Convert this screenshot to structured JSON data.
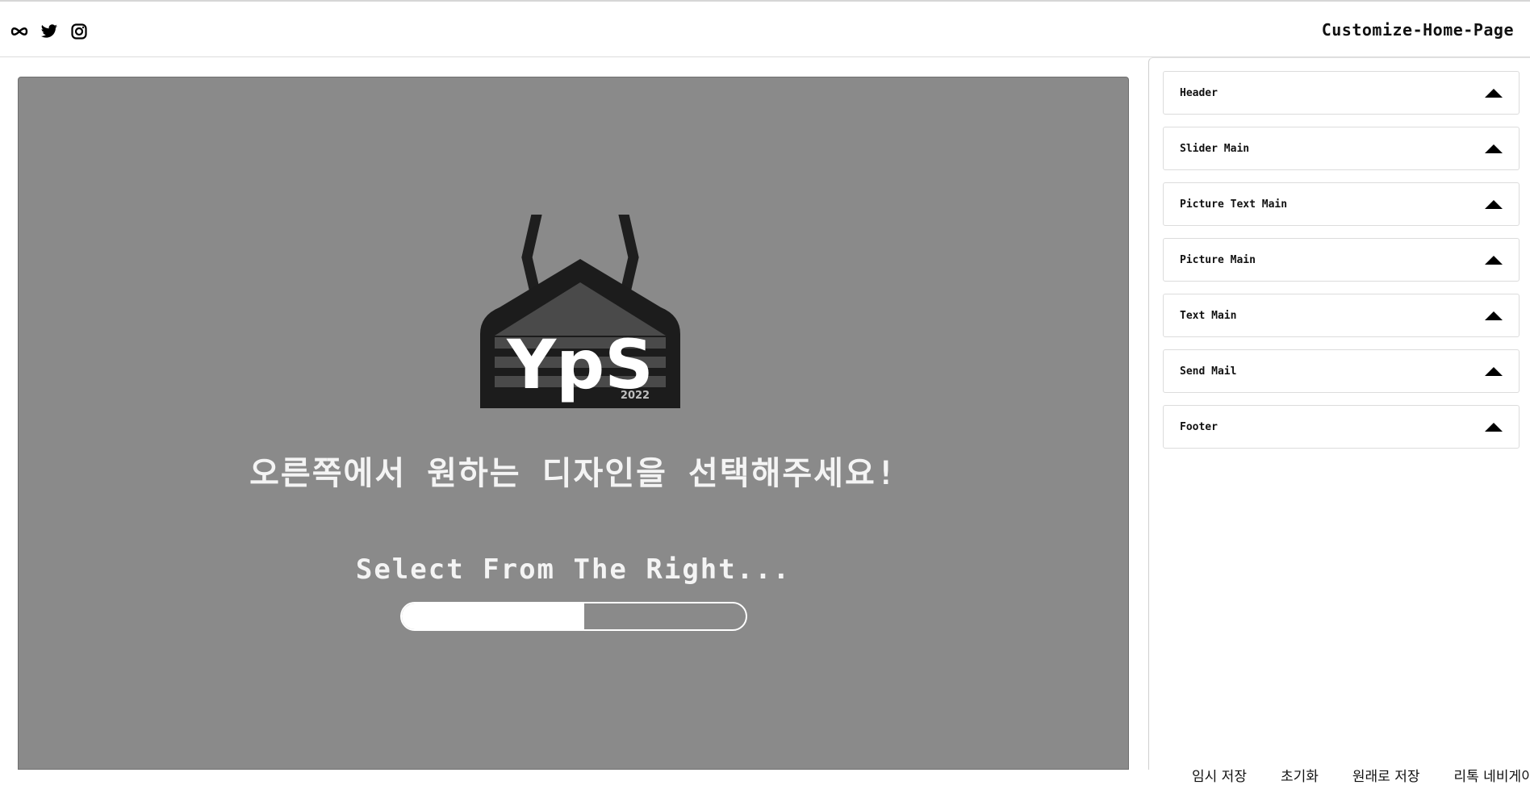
{
  "header": {
    "title": "Customize-Home-Page",
    "social_icons": [
      "meta-icon",
      "twitter-icon",
      "instagram-icon"
    ]
  },
  "preview": {
    "logo_text": "YpS",
    "logo_year": "2022",
    "message_ko": "오른쪽에서 원하는 디자인을 선택해주세요!",
    "message_en": "Select From The Right...",
    "progress_fraction": 0.53
  },
  "sidebar": {
    "items": [
      {
        "label": "Header"
      },
      {
        "label": "Slider Main"
      },
      {
        "label": "Picture Text Main"
      },
      {
        "label": "Picture Main"
      },
      {
        "label": "Text Main"
      },
      {
        "label": "Send Mail"
      },
      {
        "label": "Footer"
      }
    ],
    "actions": [
      "임시 저장",
      "초기화",
      "원래로 저장",
      "리톡 네비게이"
    ]
  },
  "colors": {
    "preview_bg": "#8a8a8a",
    "text_light": "#f4f4f4",
    "dark": "#111111"
  }
}
